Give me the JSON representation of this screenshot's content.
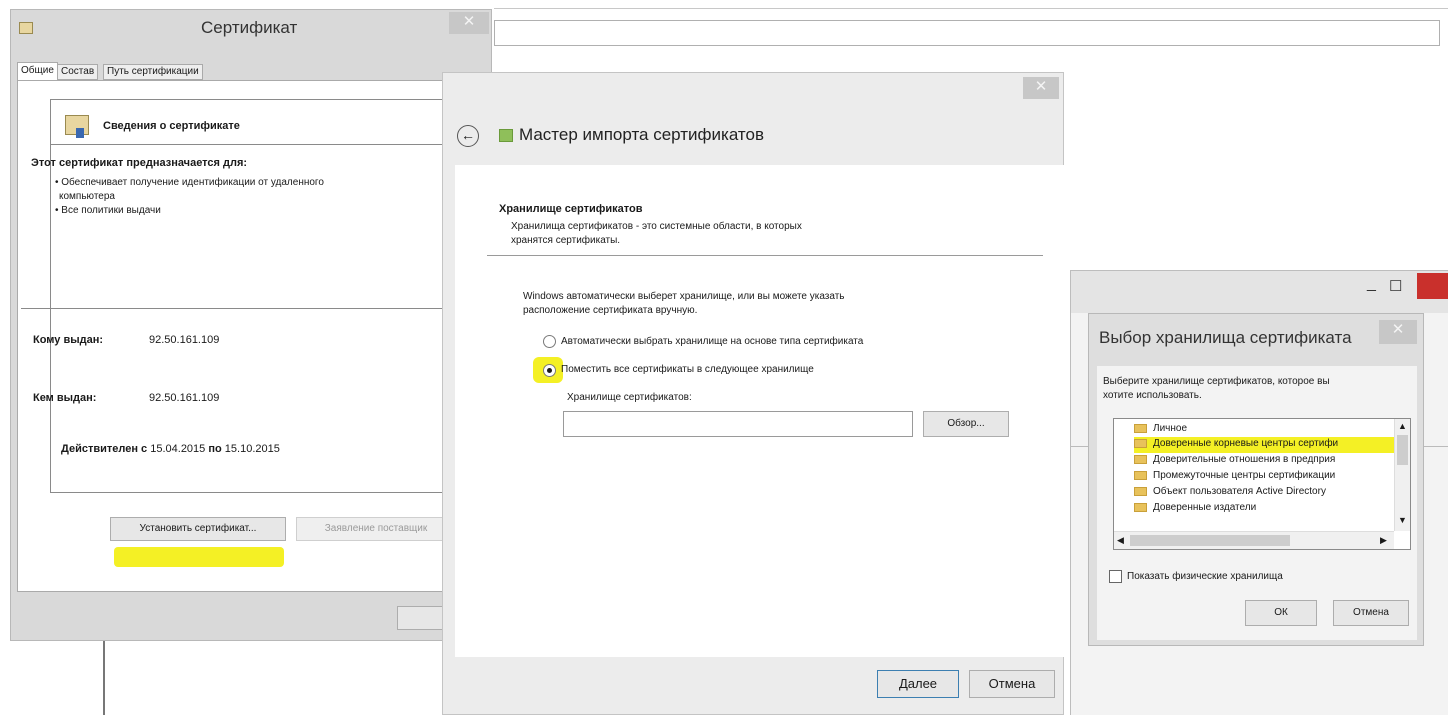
{
  "cert_dialog": {
    "title": "Сертификат",
    "close": "✕",
    "tabs": [
      "Общие",
      "Состав",
      "Путь сертификации"
    ],
    "info_heading": "Сведения о сертификате",
    "purpose_heading": "Этот сертификат предназначается для:",
    "purpose_items": [
      "• Обеспечивает получение идентификации от удаленного",
      "компьютера",
      "• Все политики выдачи"
    ],
    "issued_to_label": "Кому выдан:",
    "issued_to_value": "92.50.161.109",
    "issued_by_label": "Кем выдан:",
    "issued_by_value": "92.50.161.109",
    "valid_from_label": "Действителен с",
    "valid_from": "15.04.2015",
    "valid_to_label": "по",
    "valid_to": "15.10.2015",
    "install_button": "Установить сертификат...",
    "issuer_statement_button": "Заявление поставщик",
    "ok_partial": "О"
  },
  "wizard": {
    "close": "✕",
    "back": "←",
    "title": "Мастер импорта сертификатов",
    "section_heading": "Хранилище сертификатов",
    "section_desc_1": "Хранилища сертификатов - это системные области, в которых",
    "section_desc_2": "хранятся сертификаты.",
    "intro_1": "Windows автоматически выберет хранилище, или вы можете указать",
    "intro_2": "расположение сертификата вручную.",
    "radio_auto": "Автоматически выбрать хранилище на основе типа сертификата",
    "radio_manual": "Поместить все сертификаты в следующее хранилище",
    "store_label": "Хранилище сертификатов:",
    "store_value": "",
    "browse_button": "Обзор...",
    "next_button": "Далее",
    "cancel_button": "Отмена"
  },
  "bg_window": {
    "minimize": "_",
    "maximize": "☐"
  },
  "store_dialog": {
    "title": "Выбор хранилища сертификата",
    "close": "✕",
    "desc_1": "Выберите хранилище сертификатов, которое вы",
    "desc_2": "хотите использовать.",
    "items": [
      "Личное",
      "Доверенные корневые центры сертифи",
      "Доверительные отношения в предприя",
      "Промежуточные центры сертификации",
      "Объект пользователя Active Directory",
      "Доверенные издатели"
    ],
    "show_physical": "Показать физические хранилища",
    "ok_button": "ОК",
    "cancel_button": "Отмена"
  },
  "colors": {
    "highlight": "#f4f025",
    "frame": "#d9d9d9",
    "close_button": "#c7c7c7"
  }
}
